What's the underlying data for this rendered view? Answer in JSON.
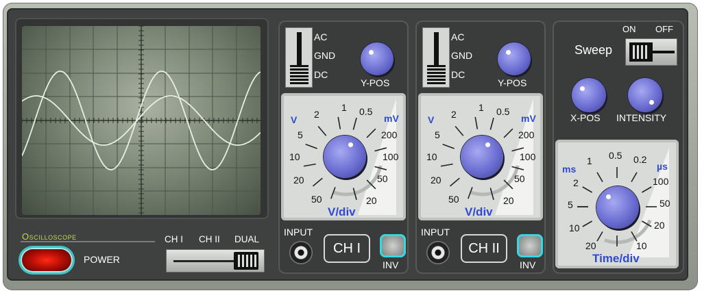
{
  "screen": {
    "traces": [
      "sine-wave-small-amplitude",
      "sine-wave-large-amplitude"
    ]
  },
  "brand": {
    "label": "Oscilloscope"
  },
  "power": {
    "label": "POWER"
  },
  "mode": {
    "options": [
      "CH I",
      "CH II",
      "DUAL"
    ],
    "selected": "DUAL"
  },
  "channels": [
    {
      "coupling": [
        "AC",
        "GND",
        "DC"
      ],
      "coupling_selected": "DC",
      "ypos_label": "Y-POS",
      "dial_unit": "V/div",
      "dial_v_label": "V",
      "dial_mv_label": "mV",
      "dial_labels": [
        "5",
        "2",
        "1",
        "0.5",
        "200",
        "100",
        "50",
        "20",
        "10",
        "20",
        "50"
      ],
      "input_label": "INPUT",
      "button_label": "CH I",
      "inv_label": "INV"
    },
    {
      "coupling": [
        "AC",
        "GND",
        "DC"
      ],
      "coupling_selected": "DC",
      "ypos_label": "Y-POS",
      "dial_unit": "V/div",
      "dial_v_label": "V",
      "dial_mv_label": "mV",
      "dial_labels": [
        "5",
        "2",
        "1",
        "0.5",
        "200",
        "100",
        "50",
        "20",
        "10",
        "20",
        "50"
      ],
      "input_label": "INPUT",
      "button_label": "CH II",
      "inv_label": "INV"
    }
  ],
  "sweep": {
    "label": "Sweep",
    "on_label": "ON",
    "off_label": "OFF",
    "state": "ON"
  },
  "xpos": {
    "label": "X-POS"
  },
  "intensity": {
    "label": "INTENSITY"
  },
  "timebase": {
    "unit": "Time/div",
    "ms_label": "ms",
    "us_label": "µs",
    "labels": [
      "1",
      "0.5",
      "0.2",
      "100",
      "50",
      "20",
      "10",
      "20",
      "10",
      "5",
      "2"
    ]
  },
  "colors": {
    "accent": "#2f4ad0",
    "inv_ring": "#35d8e2",
    "power_led": "#e2190c",
    "brand": "#c6d84e"
  }
}
